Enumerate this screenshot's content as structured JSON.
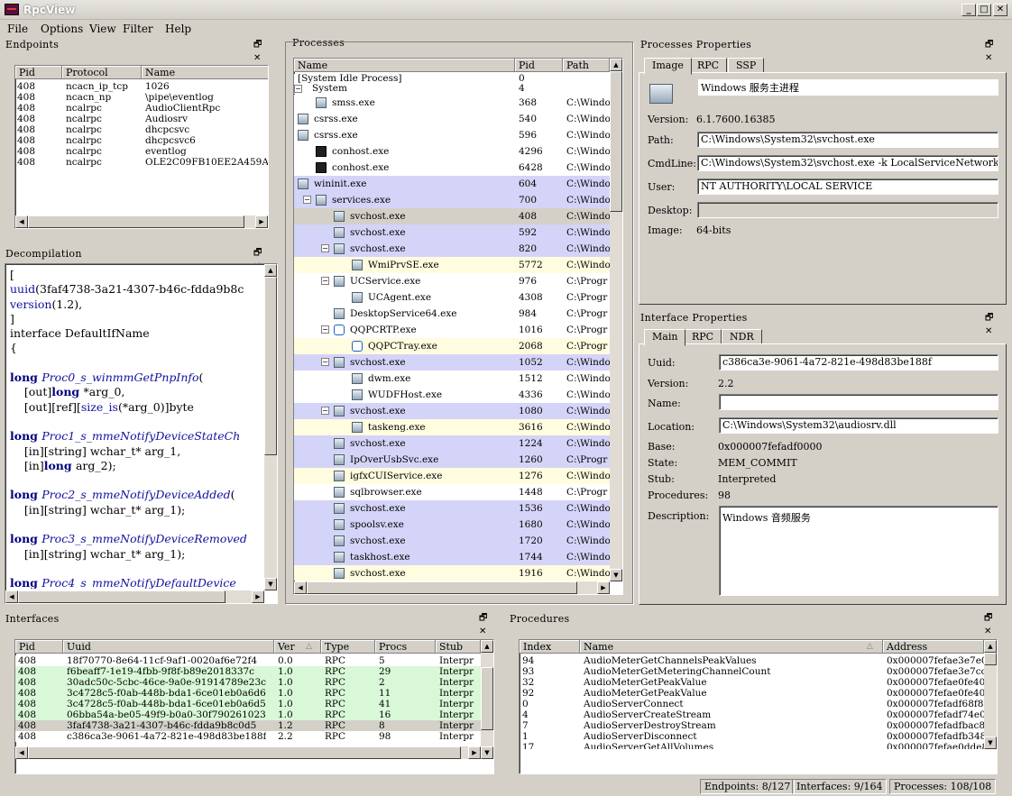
{
  "app": {
    "title": "RpcView"
  },
  "menu": [
    "File",
    "Options",
    "View",
    "Filter",
    "Help"
  ],
  "panel_buttons": "🗗 ✕",
  "endpoints": {
    "title": "Endpoints",
    "columns": [
      "Pid",
      "Protocol",
      "Name"
    ],
    "rows": [
      [
        "408",
        "ncacn_ip_tcp",
        "1026"
      ],
      [
        "408",
        "ncacn_np",
        "\\pipe\\eventlog"
      ],
      [
        "408",
        "ncalrpc",
        "AudioClientRpc"
      ],
      [
        "408",
        "ncalrpc",
        "Audiosrv"
      ],
      [
        "408",
        "ncalrpc",
        "dhcpcsvc"
      ],
      [
        "408",
        "ncalrpc",
        "dhcpcsvc6"
      ],
      [
        "408",
        "ncalrpc",
        "eventlog"
      ],
      [
        "408",
        "ncalrpc",
        "OLE2C09FB10EE2A459A8679"
      ]
    ]
  },
  "decompilation": {
    "title": "Decompilation",
    "lines": [
      [
        [
          "t",
          "["
        ]
      ],
      [
        [
          "p",
          "uuid"
        ],
        [
          "t",
          "(3faf4738-3a21-4307-b46c-fdda9b8c"
        ]
      ],
      [
        [
          "p",
          "version"
        ],
        [
          "t",
          "(1.2),"
        ]
      ],
      [
        [
          "t",
          "]"
        ]
      ],
      [
        [
          "t",
          "interface DefaultIfName"
        ]
      ],
      [
        [
          "t",
          "{"
        ]
      ],
      [
        [
          "t",
          ""
        ]
      ],
      [
        [
          "k",
          "long "
        ],
        [
          "f",
          "Proc0_s_winmmGetPnpInfo"
        ],
        [
          "t",
          "("
        ]
      ],
      [
        [
          "t",
          "    [out]"
        ],
        [
          "k",
          "long "
        ],
        [
          "t",
          "*arg_0,"
        ]
      ],
      [
        [
          "t",
          "    [out][ref]["
        ],
        [
          "p",
          "size_is"
        ],
        [
          "t",
          "(*arg_0)]byte"
        ]
      ],
      [
        [
          "t",
          ""
        ]
      ],
      [
        [
          "k",
          "long "
        ],
        [
          "f",
          "Proc1_s_mmeNotifyDeviceStateCh"
        ]
      ],
      [
        [
          "t",
          "    [in][string] wchar_t* arg_1,"
        ]
      ],
      [
        [
          "t",
          "    [in]"
        ],
        [
          "k",
          "long "
        ],
        [
          "t",
          "arg_2);"
        ]
      ],
      [
        [
          "t",
          ""
        ]
      ],
      [
        [
          "k",
          "long "
        ],
        [
          "f",
          "Proc2_s_mmeNotifyDeviceAdded"
        ],
        [
          "t",
          "("
        ]
      ],
      [
        [
          "t",
          "    [in][string] wchar_t* arg_1);"
        ]
      ],
      [
        [
          "t",
          ""
        ]
      ],
      [
        [
          "k",
          "long "
        ],
        [
          "f",
          "Proc3_s_mmeNotifyDeviceRemoved"
        ]
      ],
      [
        [
          "t",
          "    [in][string] wchar_t* arg_1);"
        ]
      ],
      [
        [
          "t",
          ""
        ]
      ],
      [
        [
          "k",
          "long "
        ],
        [
          "f",
          "Proc4_s_mmeNotifyDefaultDevice"
        ]
      ]
    ]
  },
  "processes": {
    "title": "Processes",
    "columns": [
      "Name",
      "Pid",
      "Path"
    ],
    "rows": [
      {
        "name": "[System Idle Process]",
        "pid": "0",
        "path": "",
        "level": 0,
        "icon": "none",
        "bg": "#ffffff",
        "exp": ""
      },
      {
        "name": "System",
        "pid": "4",
        "path": "",
        "level": 0,
        "icon": "none",
        "bg": "#ffffff",
        "exp": "-"
      },
      {
        "name": "smss.exe",
        "pid": "368",
        "path": "C:\\Windo",
        "level": 1,
        "icon": "app",
        "bg": "#ffffff",
        "exp": ""
      },
      {
        "name": "csrss.exe",
        "pid": "540",
        "path": "C:\\Windo",
        "level": 0,
        "icon": "app",
        "bg": "#ffffff",
        "exp": ""
      },
      {
        "name": "csrss.exe",
        "pid": "596",
        "path": "C:\\Windo",
        "level": 0,
        "icon": "app",
        "bg": "#ffffff",
        "exp": ""
      },
      {
        "name": "conhost.exe",
        "pid": "4296",
        "path": "C:\\Windo",
        "level": 1,
        "icon": "dark",
        "bg": "#ffffff",
        "exp": ""
      },
      {
        "name": "conhost.exe",
        "pid": "6428",
        "path": "C:\\Windo",
        "level": 1,
        "icon": "dark",
        "bg": "#ffffff",
        "exp": ""
      },
      {
        "name": "wininit.exe",
        "pid": "604",
        "path": "C:\\Windo",
        "level": 0,
        "icon": "app",
        "bg": "#d4d4f8",
        "exp": ""
      },
      {
        "name": "services.exe",
        "pid": "700",
        "path": "C:\\Windo",
        "level": 1,
        "icon": "app",
        "bg": "#d4d4f8",
        "exp": "-"
      },
      {
        "name": "svchost.exe",
        "pid": "408",
        "path": "C:\\Windo",
        "level": 2,
        "icon": "app",
        "bg": "#d4d0c8",
        "exp": ""
      },
      {
        "name": "svchost.exe",
        "pid": "592",
        "path": "C:\\Windo",
        "level": 2,
        "icon": "app",
        "bg": "#d4d4f8",
        "exp": ""
      },
      {
        "name": "svchost.exe",
        "pid": "820",
        "path": "C:\\Windo",
        "level": 2,
        "icon": "app",
        "bg": "#d4d4f8",
        "exp": "-"
      },
      {
        "name": "WmiPrvSE.exe",
        "pid": "5772",
        "path": "C:\\Windo",
        "level": 3,
        "icon": "app",
        "bg": "#fffce0",
        "exp": ""
      },
      {
        "name": "UCService.exe",
        "pid": "976",
        "path": "C:\\Progr",
        "level": 2,
        "icon": "app",
        "bg": "#ffffff",
        "exp": "-"
      },
      {
        "name": "UCAgent.exe",
        "pid": "4308",
        "path": "C:\\Progr",
        "level": 3,
        "icon": "app",
        "bg": "#ffffff",
        "exp": ""
      },
      {
        "name": "DesktopService64.exe",
        "pid": "984",
        "path": "C:\\Progr",
        "level": 2,
        "icon": "app",
        "bg": "#ffffff",
        "exp": ""
      },
      {
        "name": "QQPCRTP.exe",
        "pid": "1016",
        "path": "C:\\Progr",
        "level": 2,
        "icon": "blue",
        "bg": "#ffffff",
        "exp": "-"
      },
      {
        "name": "QQPCTray.exe",
        "pid": "2068",
        "path": "C:\\Progr",
        "level": 3,
        "icon": "blue",
        "bg": "#fffce0",
        "exp": ""
      },
      {
        "name": "svchost.exe",
        "pid": "1052",
        "path": "C:\\Windo",
        "level": 2,
        "icon": "app",
        "bg": "#d4d4f8",
        "exp": "-"
      },
      {
        "name": "dwm.exe",
        "pid": "1512",
        "path": "C:\\Windo",
        "level": 3,
        "icon": "app",
        "bg": "#ffffff",
        "exp": ""
      },
      {
        "name": "WUDFHost.exe",
        "pid": "4336",
        "path": "C:\\Windo",
        "level": 3,
        "icon": "app",
        "bg": "#ffffff",
        "exp": ""
      },
      {
        "name": "svchost.exe",
        "pid": "1080",
        "path": "C:\\Windo",
        "level": 2,
        "icon": "app",
        "bg": "#d4d4f8",
        "exp": "-"
      },
      {
        "name": "taskeng.exe",
        "pid": "3616",
        "path": "C:\\Windo",
        "level": 3,
        "icon": "app",
        "bg": "#fffce0",
        "exp": ""
      },
      {
        "name": "svchost.exe",
        "pid": "1224",
        "path": "C:\\Windo",
        "level": 2,
        "icon": "app",
        "bg": "#d4d4f8",
        "exp": ""
      },
      {
        "name": "IpOverUsbSvc.exe",
        "pid": "1260",
        "path": "C:\\Progr",
        "level": 2,
        "icon": "app",
        "bg": "#d4d4f8",
        "exp": ""
      },
      {
        "name": "igfxCUIService.exe",
        "pid": "1276",
        "path": "C:\\Windo",
        "level": 2,
        "icon": "app",
        "bg": "#fffce0",
        "exp": ""
      },
      {
        "name": "sqlbrowser.exe",
        "pid": "1448",
        "path": "C:\\Progr",
        "level": 2,
        "icon": "app",
        "bg": "#ffffff",
        "exp": ""
      },
      {
        "name": "svchost.exe",
        "pid": "1536",
        "path": "C:\\Windo",
        "level": 2,
        "icon": "app",
        "bg": "#d4d4f8",
        "exp": ""
      },
      {
        "name": "spoolsv.exe",
        "pid": "1680",
        "path": "C:\\Windo",
        "level": 2,
        "icon": "app",
        "bg": "#d4d4f8",
        "exp": ""
      },
      {
        "name": "svchost.exe",
        "pid": "1720",
        "path": "C:\\Windo",
        "level": 2,
        "icon": "app",
        "bg": "#d4d4f8",
        "exp": ""
      },
      {
        "name": "taskhost.exe",
        "pid": "1744",
        "path": "C:\\Windo",
        "level": 2,
        "icon": "app",
        "bg": "#d4d4f8",
        "exp": ""
      },
      {
        "name": "svchost.exe",
        "pid": "1916",
        "path": "C:\\Windo",
        "level": 2,
        "icon": "app",
        "bg": "#fffce0",
        "exp": ""
      }
    ]
  },
  "process_props": {
    "title": "Processes Properties",
    "tabs": [
      "Image",
      "RPC",
      "SSP"
    ],
    "description": "Windows 服务主进程",
    "labels": {
      "version": "Version:",
      "path": "Path:",
      "cmdline": "CmdLine:",
      "user": "User:",
      "desktop": "Desktop:",
      "image": "Image:"
    },
    "version": "6.1.7600.16385",
    "path": "C:\\Windows\\System32\\svchost.exe",
    "cmdline": "C:\\Windows\\System32\\svchost.exe -k LocalServiceNetworkR",
    "user": "NT AUTHORITY\\LOCAL SERVICE",
    "desktop": "",
    "image": "64-bits"
  },
  "interface_props": {
    "title": "Interface Properties",
    "tabs": [
      "Main",
      "RPC",
      "NDR"
    ],
    "labels": {
      "uuid": "Uuid:",
      "version": "Version:",
      "name": "Name:",
      "location": "Location:",
      "base": "Base:",
      "state": "State:",
      "stub": "Stub:",
      "procedures": "Procedures:",
      "description": "Description:"
    },
    "uuid": "c386ca3e-9061-4a72-821e-498d83be188f",
    "version": "2.2",
    "name": "",
    "location": "C:\\Windows\\System32\\audiosrv.dll",
    "base": "0x000007fefadf0000",
    "state": "MEM_COMMIT",
    "stub": "Interpreted",
    "procedures": "98",
    "description": "Windows 音频服务"
  },
  "interfaces": {
    "title": "Interfaces",
    "columns": [
      "Pid",
      "Uuid",
      "Ver",
      "Type",
      "Procs",
      "Stub"
    ],
    "rows": [
      {
        "cells": [
          "408",
          "18f70770-8e64-11cf-9af1-0020af6e72f4",
          "0.0",
          "RPC",
          "5",
          "Interpr"
        ],
        "bg": "#ffffff"
      },
      {
        "cells": [
          "408",
          "f6beaff7-1e19-4fbb-9f8f-b89e2018337c",
          "1.0",
          "RPC",
          "29",
          "Interpr"
        ],
        "bg": "#d8f8d8"
      },
      {
        "cells": [
          "408",
          "30adc50c-5cbc-46ce-9a0e-91914789e23c",
          "1.0",
          "RPC",
          "2",
          "Interpr"
        ],
        "bg": "#d8f8d8"
      },
      {
        "cells": [
          "408",
          "3c4728c5-f0ab-448b-bda1-6ce01eb0a6d6",
          "1.0",
          "RPC",
          "11",
          "Interpr"
        ],
        "bg": "#d8f8d8"
      },
      {
        "cells": [
          "408",
          "3c4728c5-f0ab-448b-bda1-6ce01eb0a6d5",
          "1.0",
          "RPC",
          "41",
          "Interpr"
        ],
        "bg": "#d8f8d8"
      },
      {
        "cells": [
          "408",
          "06bba54a-be05-49f9-b0a0-30f790261023",
          "1.0",
          "RPC",
          "16",
          "Interpr"
        ],
        "bg": "#d8f8d8"
      },
      {
        "cells": [
          "408",
          "3faf4738-3a21-4307-b46c-fdda9b8c0d5",
          "1.2",
          "RPC",
          "8",
          "Interpr"
        ],
        "bg": "#d4d0c8"
      },
      {
        "cells": [
          "408",
          "c386ca3e-9061-4a72-821e-498d83be188f",
          "2.2",
          "RPC",
          "98",
          "Interpr"
        ],
        "bg": "#ffffff"
      }
    ]
  },
  "procedures": {
    "title": "Procedures",
    "columns": [
      "Index",
      "Name",
      "Address"
    ],
    "rows": [
      [
        "94",
        "AudioMeterGetChannelsPeakValues",
        "0x000007fefae3e7e0"
      ],
      [
        "93",
        "AudioMeterGetMeteringChannelCount",
        "0x000007fefae3e7cc"
      ],
      [
        "32",
        "AudioMeterGetPeakValue",
        "0x000007fefae0fe40"
      ],
      [
        "92",
        "AudioMeterGetPeakValue",
        "0x000007fefae0fe40"
      ],
      [
        "0",
        "AudioServerConnect",
        "0x000007fefadf68f8"
      ],
      [
        "4",
        "AudioServerCreateStream",
        "0x000007fefadf74e0"
      ],
      [
        "7",
        "AudioServerDestroyStream",
        "0x000007fefadfbac8"
      ],
      [
        "1",
        "AudioServerDisconnect",
        "0x000007fefadfb348"
      ],
      [
        "17",
        "AudioServerGetAllVolumes",
        "0x000007fefae0dde8"
      ]
    ]
  },
  "status": {
    "endpoints": "Endpoints: 8/127",
    "interfaces": "Interfaces: 9/164",
    "processes": "Processes: 108/108"
  }
}
